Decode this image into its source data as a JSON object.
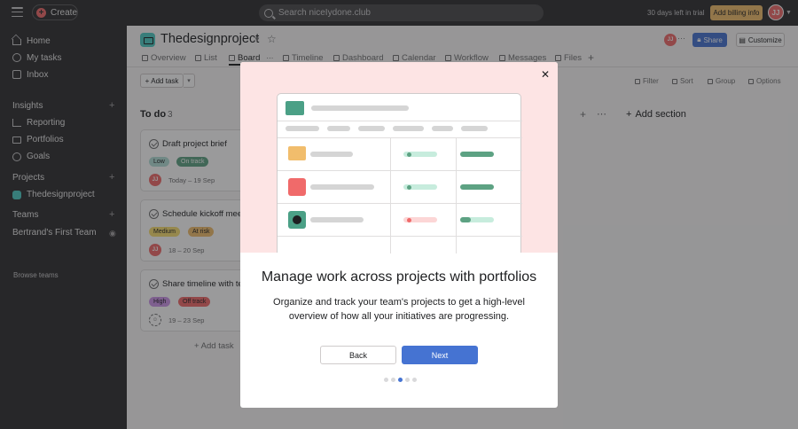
{
  "topbar": {
    "create_label": "Create",
    "search_placeholder": "Search niceIydone.club",
    "trial_text": "30 days left in trial",
    "billing_label": "Add billing info",
    "avatar_initials": "JJ"
  },
  "sidebar": {
    "nav": [
      {
        "label": "Home",
        "icon": "home-icon"
      },
      {
        "label": "My tasks",
        "icon": "check-circle-icon"
      },
      {
        "label": "Inbox",
        "icon": "inbox-icon"
      }
    ],
    "insights_title": "Insights",
    "insights": [
      {
        "label": "Reporting",
        "icon": "chart-icon"
      },
      {
        "label": "Portfolios",
        "icon": "folder-icon"
      },
      {
        "label": "Goals",
        "icon": "target-icon"
      }
    ],
    "projects_title": "Projects",
    "projects": [
      {
        "label": "Thedesignproject",
        "color": "#4ecbc4"
      }
    ],
    "teams_title": "Teams",
    "team_name": "Bertrand's First Team",
    "browse_label": "Browse teams"
  },
  "project": {
    "title": "Thedesignproject",
    "share_label": "Share",
    "customize_label": "Customize",
    "tabs": [
      {
        "label": "Overview"
      },
      {
        "label": "List"
      },
      {
        "label": "Board"
      },
      {
        "label": "Timeline"
      },
      {
        "label": "Dashboard"
      },
      {
        "label": "Calendar"
      },
      {
        "label": "Workflow"
      },
      {
        "label": "Messages"
      },
      {
        "label": "Files"
      }
    ],
    "active_tab": "Board"
  },
  "toolbar": {
    "add_task_label": "Add task",
    "filter_label": "Filter",
    "sort_label": "Sort",
    "group_label": "Group",
    "options_label": "Options"
  },
  "board": {
    "column_title": "To do",
    "column_count": "3",
    "cards": [
      {
        "title": "Draft project brief",
        "priority": "Low",
        "status": "On track",
        "date": "Today – 19 Sep",
        "assignee": "JJ"
      },
      {
        "title": "Schedule kickoff meeting",
        "priority": "Medium",
        "status": "At risk",
        "date": "18 – 20 Sep",
        "assignee": "JJ"
      },
      {
        "title": "Share timeline with team",
        "priority": "High",
        "status": "Off track",
        "date": "19 – 23 Sep",
        "assignee": ""
      }
    ],
    "add_task_label": "Add task",
    "add_section_label": "Add section"
  },
  "modal": {
    "title": "Manage work across projects with portfolios",
    "description": "Organize and track your team's projects to get a high-level overview of how all your initiatives are progressing.",
    "back_label": "Back",
    "next_label": "Next",
    "page_count": 5,
    "current_page": 3
  },
  "colors": {
    "accent": "#4573d2",
    "brand": "#f06a6a",
    "hero_bg": "#fde4e4"
  }
}
